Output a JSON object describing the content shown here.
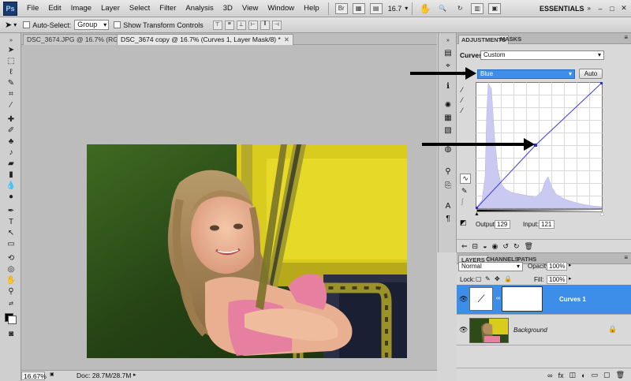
{
  "menubar": {
    "logo": "Ps",
    "items": [
      "File",
      "Edit",
      "Image",
      "Layer",
      "Select",
      "Filter",
      "Analysis",
      "3D",
      "View",
      "Window",
      "Help"
    ],
    "bridge_label": "Br",
    "zoom": "16.7",
    "workspace": "ESSENTIALS",
    "window_controls": [
      "–",
      "□",
      "✕"
    ]
  },
  "options": {
    "auto_select_label": "Auto-Select:",
    "auto_select_value": "Group",
    "show_transform_label": "Show Transform Controls"
  },
  "tabs": [
    {
      "label": "DSC_3674.JPG @ 16.7% (RGB/8)",
      "active": false
    },
    {
      "label": "DSC_3674 copy @ 16.7% (Curves 1, Layer Mask/8) *",
      "active": true
    }
  ],
  "status": {
    "zoom": "16.67%",
    "doc": "Doc: 28.7M/28.7M"
  },
  "adjustments": {
    "tabs": [
      "ADJUSTMENTS",
      "MASKS"
    ],
    "preset_label": "Curves",
    "preset_value": "Custom",
    "channel": "Blue",
    "auto_button": "Auto",
    "output_label": "Output:",
    "output_value": "129",
    "input_label": "Input:",
    "input_value": "121",
    "curve_color": "#3a3ae0",
    "histogram_color": "#c9c9f2"
  },
  "layers": {
    "tabs": [
      "LAYERS",
      "CHANNELS",
      "PATHS"
    ],
    "blend_mode": "Normal",
    "opacity_label": "Opacity:",
    "opacity_value": "100%",
    "lock_label": "Lock:",
    "fill_label": "Fill:",
    "fill_value": "100%",
    "items": [
      {
        "name": "Curves 1",
        "selected": true
      },
      {
        "name": "Background",
        "selected": false
      }
    ],
    "selected_color": "#3d8ee8"
  }
}
